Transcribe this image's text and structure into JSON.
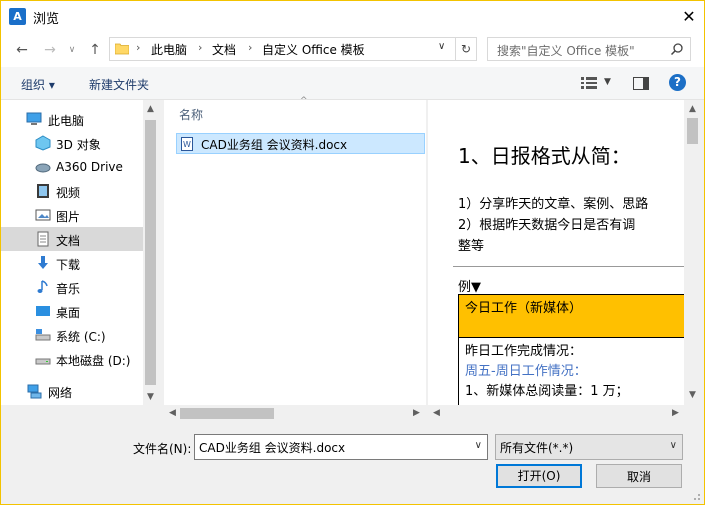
{
  "window": {
    "title": "浏览",
    "app_icon": "A",
    "accent": "#f3c300"
  },
  "address": {
    "crumbs": [
      "此电脑",
      "文档",
      "自定义 Office 模板"
    ],
    "search_placeholder": "搜索\"自定义 Office 模板\""
  },
  "toolbar": {
    "organize": "组织 ▾",
    "new_folder": "新建文件夹",
    "help": "?"
  },
  "nav": {
    "items": [
      {
        "label": "此电脑",
        "icon": "computer-icon"
      },
      {
        "label": "3D 对象",
        "icon": "3d-objects-icon"
      },
      {
        "label": "A360 Drive",
        "icon": "cloud-drive-icon"
      },
      {
        "label": "视频",
        "icon": "video-icon"
      },
      {
        "label": "图片",
        "icon": "pictures-icon"
      },
      {
        "label": "文档",
        "icon": "documents-icon",
        "selected": true
      },
      {
        "label": "下载",
        "icon": "download-icon"
      },
      {
        "label": "音乐",
        "icon": "music-icon"
      },
      {
        "label": "桌面",
        "icon": "desktop-icon"
      },
      {
        "label": "系统 (C:)",
        "icon": "system-drive-icon"
      },
      {
        "label": "本地磁盘 (D:)",
        "icon": "local-disk-icon"
      },
      {
        "label": "网络",
        "icon": "network-icon"
      }
    ]
  },
  "files": {
    "column_name": "名称",
    "items": [
      {
        "name": "CAD业务组 会议资料.docx",
        "selected": true
      }
    ]
  },
  "preview": {
    "heading": "1、日报格式从简：",
    "line1": "1）分享昨天的文章、案例、思路",
    "line2": "2）根据昨天数据今日是否有调",
    "line3": "整等",
    "example": "例▼",
    "table_header": "今日工作（新媒体）",
    "table_line1": "昨日工作完成情况：",
    "table_line2": "周五-周日工作情况：",
    "table_line3": "1、新媒体总阅读量：1 万；",
    "colors": {
      "header_fill": "#ffc000",
      "link_blue": "#4472c4"
    }
  },
  "bottom": {
    "filename_label": "文件名(N):",
    "filename_value": "CAD业务组 会议资料.docx",
    "filetype_value": "所有文件(*.*)",
    "open_button": "打开(O)",
    "cancel_button": "取消"
  }
}
